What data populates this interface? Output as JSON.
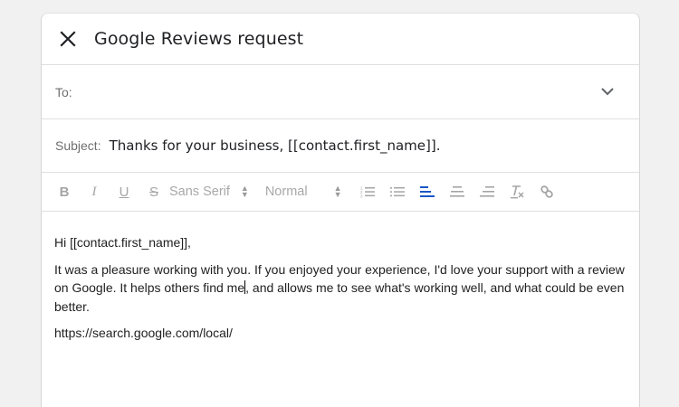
{
  "dialog": {
    "title": "Google Reviews request",
    "to_label": "To:",
    "subject_label": "Subject:",
    "subject_value": "Thanks for your business, [[contact.first_name]]."
  },
  "toolbar": {
    "bold": "B",
    "italic": "I",
    "underline": "U",
    "strike": "S",
    "font": "Sans Serif",
    "size": "Normal"
  },
  "body": {
    "greeting": "Hi [[contact.first_name]],",
    "p1_before_caret": "It was a pleasure working with you. If you enjoyed your experience, I'd love your support with a review on Google. It helps others find me",
    "p1_after_caret": ", and allows me to see what's working well, and what could be even better.",
    "link": "https://search.google.com/local/"
  },
  "colors": {
    "accent": "#1a57c7",
    "text": "#202124",
    "muted": "#a8a8a8"
  }
}
